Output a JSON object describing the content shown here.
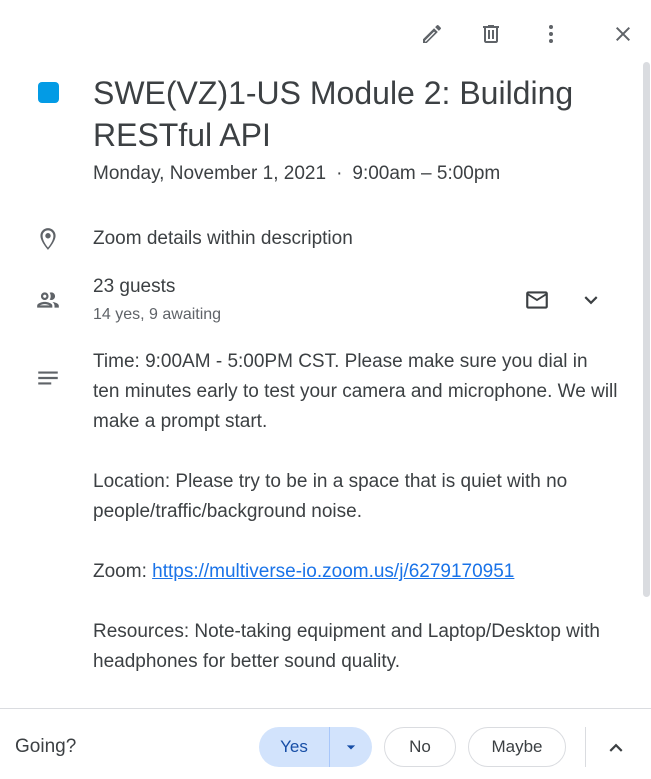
{
  "toolbar": {
    "edit_icon": "pencil-icon",
    "delete_icon": "trash-icon",
    "more_icon": "more-vert-icon",
    "close_icon": "close-icon"
  },
  "event": {
    "color": "#039be5",
    "title": "SWE(VZ)1-US Module 2: Building RESTful API",
    "date": "Monday, November 1, 2021",
    "separator": "·",
    "time": "9:00am – 5:00pm"
  },
  "location": {
    "icon": "location-pin-icon",
    "text": "Zoom details within description"
  },
  "guests": {
    "icon": "people-icon",
    "title": "23 guests",
    "summary": "14 yes, 9 awaiting",
    "email_icon": "mail-icon",
    "expand_icon": "chevron-down-icon"
  },
  "description": {
    "icon": "notes-icon",
    "time_text": "Time: 9:00AM - 5:00PM CST. Please make sure you dial in ten minutes early to test your camera and microphone. We will make a prompt start.",
    "location_text": "Location: Please try to be in a space that is quiet with no people/traffic/background noise.",
    "zoom_label": "Zoom: ",
    "zoom_link": "https://multiverse-io.zoom.us/j/6279170951",
    "resources_text": "Resources: Note-taking equipment and Laptop/Desktop with headphones for better sound quality."
  },
  "footer": {
    "going_label": "Going?",
    "yes_label": "Yes",
    "no_label": "No",
    "maybe_label": "Maybe",
    "selected": "Yes",
    "collapse_icon": "chevron-up-icon"
  },
  "colors": {
    "accent": "#1a73e8",
    "selected_bg": "#d2e3fc",
    "event_color": "#039be5"
  }
}
